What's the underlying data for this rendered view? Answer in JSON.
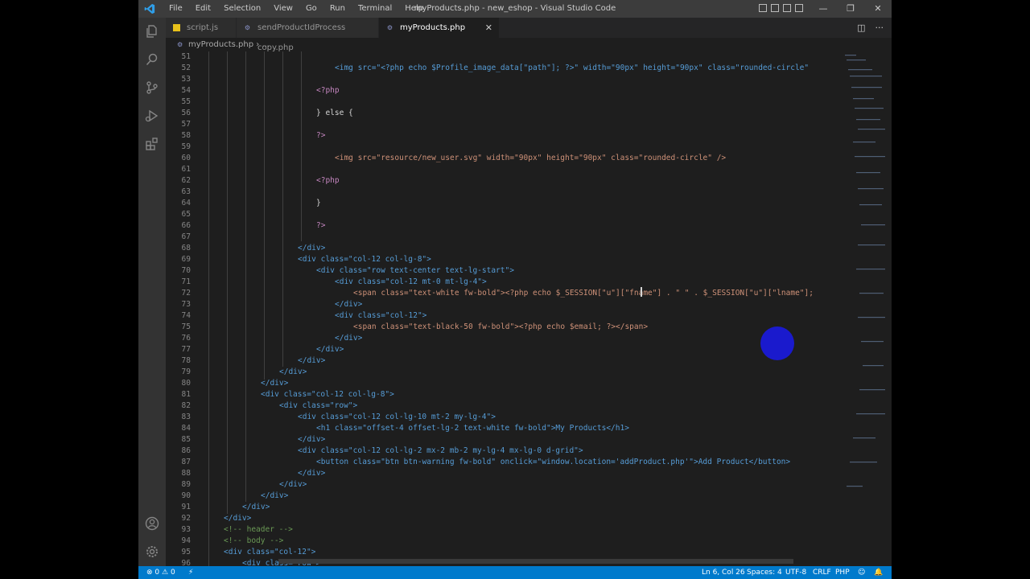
{
  "window": {
    "title": "myProducts.php - new_eshop - Visual Studio Code",
    "menu": [
      "File",
      "Edit",
      "Selection",
      "View",
      "Go",
      "Run",
      "Terminal",
      "Help"
    ],
    "controls": {
      "minimize": "—",
      "restore": "❐",
      "close": "✕"
    }
  },
  "activity_bar": {
    "icons": [
      "files-icon",
      "search-icon",
      "source-control-icon",
      "run-debug-icon",
      "extensions-icon",
      "account-icon",
      "settings-gear-icon"
    ]
  },
  "tabs": [
    {
      "label": "script.js",
      "icon": "js-file-icon",
      "active": false
    },
    {
      "label": "sendProductIdProcess copy.php",
      "icon": "php-file-icon",
      "active": false
    },
    {
      "label": "myProducts.php",
      "icon": "php-file-icon",
      "active": true
    }
  ],
  "breadcrumb": {
    "file": "myProducts.php",
    "separator": "›",
    "rest": "..."
  },
  "editor": {
    "line_numbers": [
      "51",
      "52",
      "53",
      "54",
      "55",
      "56",
      "57",
      "58",
      "59",
      "60",
      "61",
      "62",
      "63",
      "64",
      "65",
      "66",
      "67",
      "68",
      "69",
      "70",
      "71",
      "72",
      "73",
      "74",
      "75",
      "76",
      "77",
      "78",
      "79",
      "80",
      "81",
      "82",
      "83",
      "84",
      "85",
      "86",
      "87",
      "88",
      "89",
      "90",
      "91",
      "92",
      "93",
      "94",
      "95",
      "96"
    ],
    "lines": {
      "l52": "<img src=\"<?php echo $Profile_image_data[\"path\"]; ?>\" width=\"90px\" height=\"90px\" class=\"rounded-circle\" />",
      "l54": "<?php",
      "l56": "} else {",
      "l58": "?>",
      "l60": "<img src=\"resource/new_user.svg\" width=\"90px\" height=\"90px\" class=\"rounded-circle\" />",
      "l62": "<?php",
      "l64": "}",
      "l66": "?>",
      "l68": "</div>",
      "l69": "<div class=\"col-12 col-lg-8\">",
      "l70": "<div class=\"row text-center text-lg-start\">",
      "l71": "<div class=\"col-12 mt-0 mt-lg-4\">",
      "l72": "<span class=\"text-white fw-bold\"><?php echo $_SESSION[\"u\"][\"fname\"] . \" \" . $_SESSION[\"u\"][\"lname\"]; ?",
      "l73": "</div>",
      "l74": "<div class=\"col-12\">",
      "l75": "<span class=\"text-black-50 fw-bold\"><?php echo $email; ?></span>",
      "l76": "</div>",
      "l77": "</div>",
      "l78": "</div>",
      "l79": "</div>",
      "l80": "</div>",
      "l81": "<div class=\"col-12 col-lg-8\">",
      "l82": "<div class=\"row\">",
      "l83": "<div class=\"col-12 col-lg-10 mt-2 my-lg-4\">",
      "l84": "<h1 class=\"offset-4 offset-lg-2 text-white fw-bold\">My Products</h1>",
      "l85": "</div>",
      "l86": "<div class=\"col-12 col-lg-2 mx-2 mb-2 my-lg-4 mx-lg-0 d-grid\">",
      "l87": "<button class=\"btn btn-warning fw-bold\" onclick=\"window.location='addProduct.php'\">Add Product</button>",
      "l88": "</div>",
      "l89": "</div>",
      "l90": "</div>",
      "l91": "</div>",
      "l92": "</div>",
      "l93": "<!-- header -->",
      "l94": "<!-- body -->",
      "l95": "<div class=\"col-12\">",
      "l96": "<div class=\"row\">"
    }
  },
  "statusbar": {
    "errors": "0",
    "warnings": "0",
    "position": "Ln 6, Col 26",
    "spaces": "Spaces: 4",
    "encoding": "UTF-8",
    "eol": "CRLF",
    "language": "PHP"
  },
  "colors": {
    "accent": "#007acc",
    "editor_bg": "#1e1e1e",
    "titlebar_bg": "#3c3c3c",
    "activity_bg": "#333333"
  }
}
